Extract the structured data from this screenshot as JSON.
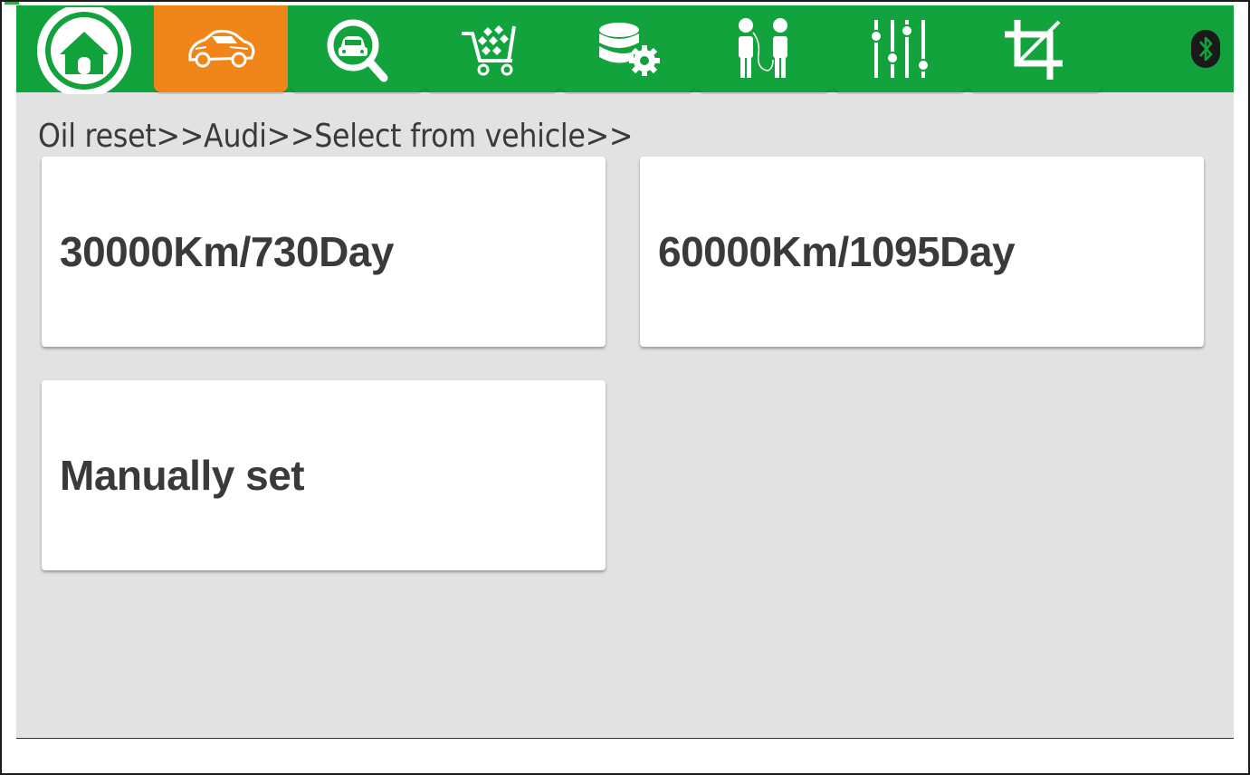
{
  "colors": {
    "bar_green": "#12a23c",
    "active_orange": "#f0861a",
    "content_bg": "#e2e2e2",
    "card_bg": "#ffffff",
    "text_dark": "#3a3a3a"
  },
  "topbar": {
    "tabs": [
      {
        "icon": "home-icon",
        "active": false
      },
      {
        "icon": "car-icon",
        "active": true
      },
      {
        "icon": "car-search-icon",
        "active": false
      },
      {
        "icon": "shopping-cart-icon",
        "active": false
      },
      {
        "icon": "database-settings-icon",
        "active": false
      },
      {
        "icon": "people-talk-icon",
        "active": false
      },
      {
        "icon": "sliders-icon",
        "active": false
      },
      {
        "icon": "crop-icon",
        "active": false
      }
    ],
    "status_icon": "bluetooth-icon"
  },
  "breadcrumb": "Oil reset>>Audi>>Select from vehicle>>",
  "options": [
    {
      "label": "30000Km/730Day"
    },
    {
      "label": "60000Km/1095Day"
    },
    {
      "label": "Manually set"
    }
  ]
}
